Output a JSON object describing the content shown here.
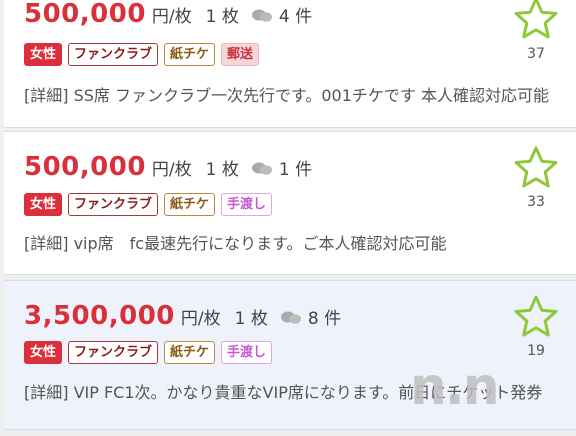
{
  "listings": [
    {
      "price": "500,000",
      "unit": "円/枚",
      "quantity": "1 枚",
      "comment_count": "4 件",
      "tags": [
        {
          "label": "女性",
          "kind": "female"
        },
        {
          "label": "ファンクラブ",
          "kind": "fanclub"
        },
        {
          "label": "紙チケ",
          "kind": "paper"
        },
        {
          "label": "郵送",
          "kind": "mail"
        }
      ],
      "description": "[詳細] SS席 ファンクラブ一次先行です。001チケです 本人確認対応可能",
      "favorites": "37"
    },
    {
      "price": "500,000",
      "unit": "円/枚",
      "quantity": "1 枚",
      "comment_count": "1 件",
      "tags": [
        {
          "label": "女性",
          "kind": "female"
        },
        {
          "label": "ファンクラブ",
          "kind": "fanclub"
        },
        {
          "label": "紙チケ",
          "kind": "paper"
        },
        {
          "label": "手渡し",
          "kind": "hand"
        }
      ],
      "description": "[詳細] vip席　fc最速先行になります。ご本人確認対応可能",
      "favorites": "33"
    },
    {
      "price": "3,500,000",
      "unit": "円/枚",
      "quantity": "1 枚",
      "comment_count": "8 件",
      "tags": [
        {
          "label": "女性",
          "kind": "female"
        },
        {
          "label": "ファンクラブ",
          "kind": "fanclub"
        },
        {
          "label": "紙チケ",
          "kind": "paper"
        },
        {
          "label": "手渡し",
          "kind": "hand"
        }
      ],
      "description": "[詳細] VIP FC1次。かなり貴重なVIP席になります。前日にチケット発券",
      "favorites": "19"
    }
  ],
  "watermark": "n.n",
  "colors": {
    "price": "#d9303b",
    "star": "#8fc93a",
    "highlight_bg": "#eef2fb"
  },
  "icons": {
    "comment": "comment-bubbles-icon",
    "favorite": "star-outline-icon"
  }
}
